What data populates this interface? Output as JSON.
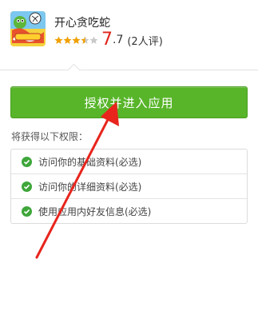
{
  "app": {
    "name": "开心贪吃蛇",
    "score_major": "7",
    "score_minor": ".7",
    "review_count": "(2人评)",
    "stars_filled": 3.5,
    "stars_total": 5,
    "icon": "snake-game-app-icon"
  },
  "authorize_button": {
    "label": "授权并进入应用",
    "color": "#58b52a"
  },
  "permissions": {
    "title": "将获得以下权限：",
    "items": [
      {
        "label": "访问你的基础资料(必选)",
        "icon": "check-icon"
      },
      {
        "label": "访问你的详细资料(必选)",
        "icon": "check-icon"
      },
      {
        "label": "使用应用内好友信息(必选)",
        "icon": "check-icon"
      }
    ]
  },
  "annotation": {
    "icon": "red-arrow-icon",
    "color": "#e8241c"
  }
}
